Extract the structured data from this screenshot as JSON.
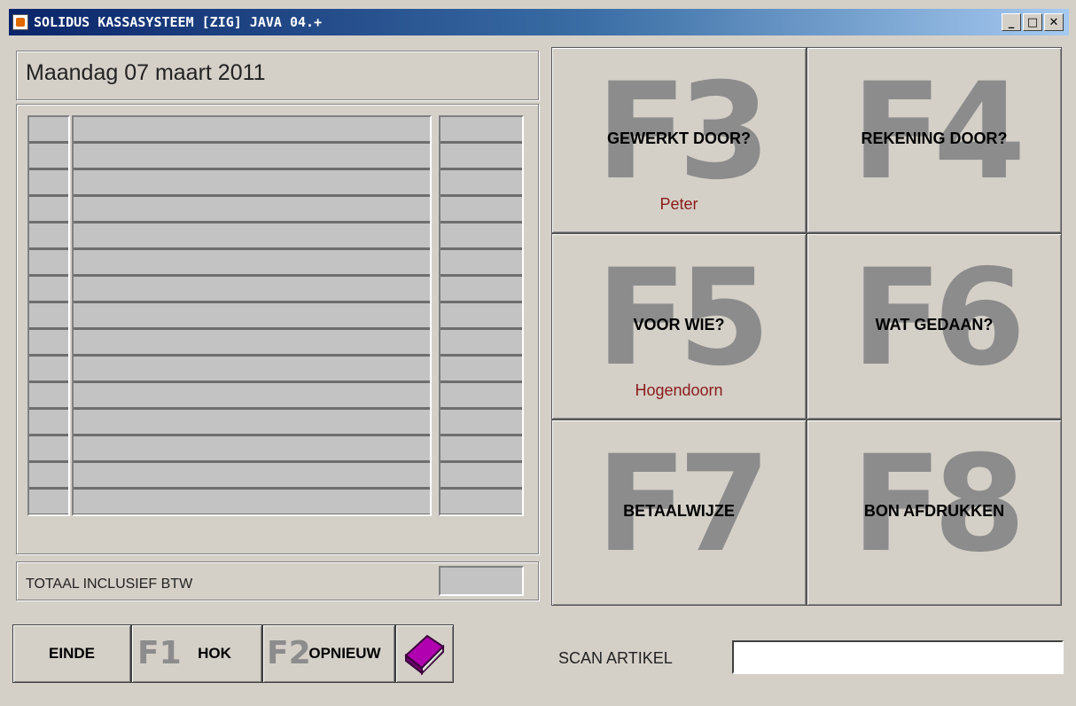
{
  "window": {
    "title": "SOLIDUS KASSASYSTEEM [ZIG] JAVA 04.+",
    "icon": "java-cup-icon",
    "controls": {
      "minimize": "_",
      "maximize": "□",
      "close": "✕"
    }
  },
  "date": "Maandag 07 maart 2011",
  "order_table": {
    "rows": 15,
    "columns": [
      "qty",
      "description",
      "price"
    ]
  },
  "total": {
    "label": "TOTAAL INCLUSIEF BTW",
    "value": ""
  },
  "function_keys": [
    {
      "key": "F3",
      "label": "GEWERKT DOOR?",
      "value": "Peter"
    },
    {
      "key": "F4",
      "label": "REKENING DOOR?",
      "value": ""
    },
    {
      "key": "F5",
      "label": "VOOR WIE?",
      "value": "Hogendoorn"
    },
    {
      "key": "F6",
      "label": "WAT GEDAAN?",
      "value": ""
    },
    {
      "key": "F7",
      "label": "BETAALWIJZE",
      "value": ""
    },
    {
      "key": "F8",
      "label": "BON AFDRUKKEN",
      "value": ""
    }
  ],
  "bottom_buttons": {
    "einde": "EINDE",
    "hok_key": "F1",
    "hok": "HOK",
    "opnieuw_key": "F2",
    "opnieuw": "OPNIEUW",
    "book_icon": "book-icon"
  },
  "scan": {
    "label": "SCAN ARTIKEL",
    "value": ""
  },
  "colors": {
    "value_text": "#8b1a1a",
    "key_watermark": "#8c8c8c",
    "background": "#d4d0c8",
    "titlebar": "#0a246a"
  }
}
